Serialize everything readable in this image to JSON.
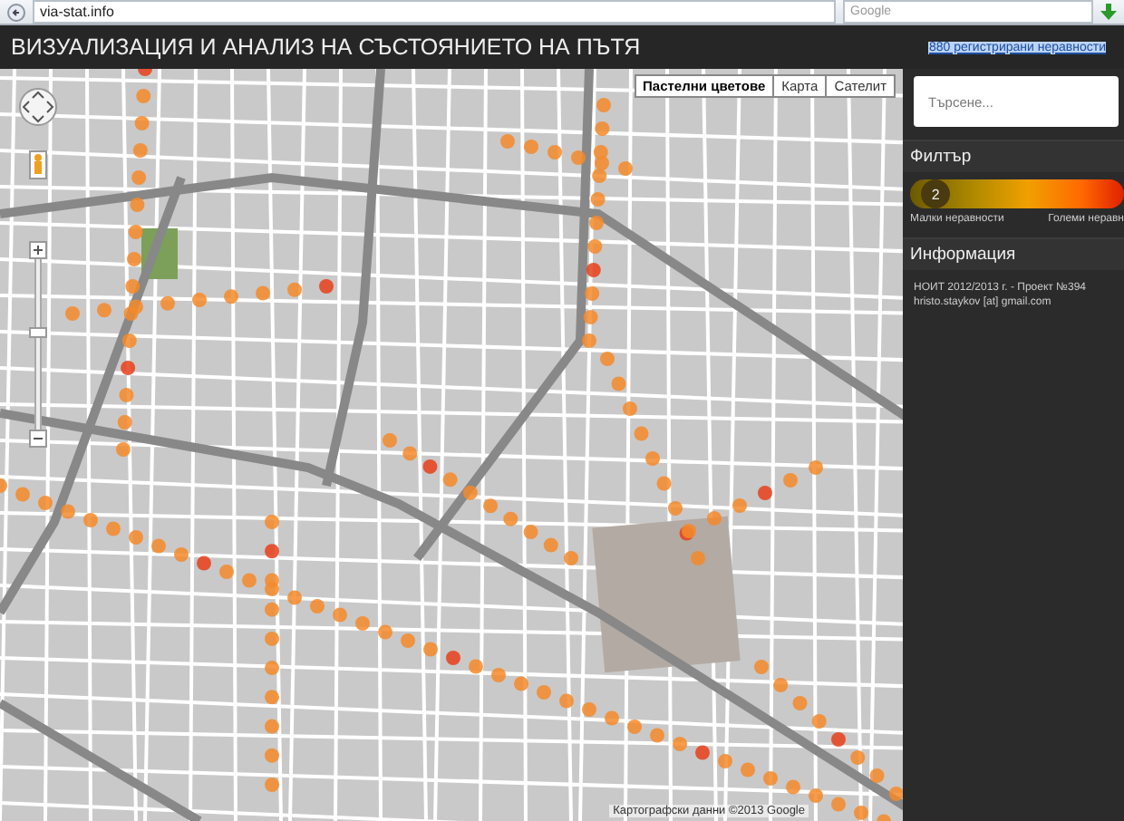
{
  "browser": {
    "address": "via-stat.info",
    "search_placeholder": "Google"
  },
  "header": {
    "title": "ВИЗУАЛИЗАЦИЯ И АНАЛИЗ НА СЪСТОЯНИЕТО НА ПЪТЯ",
    "link": "880 регистрирани неравности"
  },
  "map": {
    "types": [
      {
        "label": "Пастелни цветове",
        "selected": true
      },
      {
        "label": "Карта",
        "selected": false
      },
      {
        "label": "Сателит",
        "selected": false
      }
    ],
    "attribution": "Картографски данни ©2013 Google"
  },
  "sidebar": {
    "search_placeholder": "Търсене...",
    "filter": {
      "title": "Филтър",
      "min_handle": "2",
      "level": 0.12,
      "min_label": "Малки неравности",
      "max_label": "Големи неравн"
    },
    "info": {
      "title": "Информация",
      "lines": [
        "НОИТ 2012/2013 г. - Проект №394",
        "hristo.staykov [at] gmail.com"
      ]
    }
  }
}
